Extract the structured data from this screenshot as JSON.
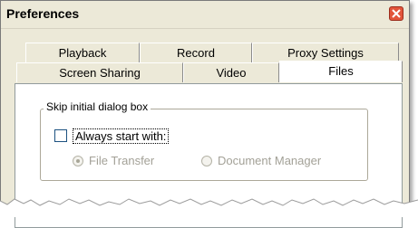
{
  "window": {
    "title": "Preferences"
  },
  "tabs": {
    "row1": [
      {
        "label": "Playback"
      },
      {
        "label": "Record"
      },
      {
        "label": "Proxy Settings"
      }
    ],
    "row2": [
      {
        "label": "Screen Sharing"
      },
      {
        "label": "Video"
      },
      {
        "label": "Files",
        "active": true
      }
    ]
  },
  "files_panel": {
    "group_label": "Skip initial dialog box",
    "always_start_with": {
      "label": "Always start with:",
      "checked": false
    },
    "radios": [
      {
        "label": "File Transfer",
        "selected": true,
        "enabled": false
      },
      {
        "label": "Document Manager",
        "selected": false,
        "enabled": false
      }
    ]
  },
  "icons": {
    "close": "close-icon"
  },
  "colors": {
    "close_button": "#e2553a",
    "window_bg": "#ece9d8"
  }
}
